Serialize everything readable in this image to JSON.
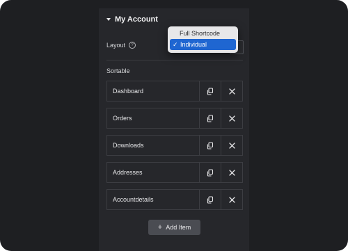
{
  "panel": {
    "section_title": "My Account",
    "layout_label": "Layout",
    "help_icon": "?",
    "sortable_label": "Sortable",
    "add_item_label": "Add Item",
    "add_icon": "+"
  },
  "layout_dropdown": {
    "options": [
      {
        "label": "Full Shortcode",
        "selected": false
      },
      {
        "label": "Individual",
        "selected": true
      }
    ],
    "check_icon": "✓"
  },
  "sortable_items": [
    {
      "label": "Dashboard"
    },
    {
      "label": "Orders"
    },
    {
      "label": "Downloads"
    },
    {
      "label": "Addresses"
    },
    {
      "label": "Accountdetails"
    }
  ],
  "colors": {
    "background": "#1e1f22",
    "panel": "#26272b",
    "selected_option": "#1f66d1"
  }
}
